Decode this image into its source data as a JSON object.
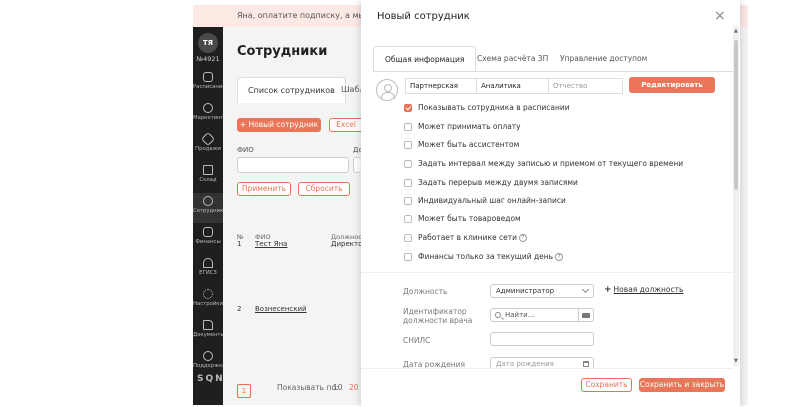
{
  "banner": {
    "text": "Яна, оплатите подписку, а мы поможем"
  },
  "sidebar": {
    "avatar": "TЯ",
    "account": "№4921",
    "items": [
      {
        "label": "Расписание",
        "icon": "calendar-icon"
      },
      {
        "label": "Маркетинг",
        "icon": "chat-icon"
      },
      {
        "label": "Продажи",
        "icon": "tag-icon"
      },
      {
        "label": "Склад",
        "icon": "box-icon"
      },
      {
        "label": "Сотрудники",
        "icon": "user-icon"
      },
      {
        "label": "Финансы",
        "icon": "wallet-icon"
      },
      {
        "label": "ЕГИСЗ",
        "icon": "caduceus-icon"
      },
      {
        "label": "Настройки",
        "icon": "gear-icon"
      },
      {
        "label": "Документы",
        "icon": "document-icon"
      },
      {
        "label": "Поддержка",
        "icon": "help-icon"
      }
    ],
    "logo": "SQNS"
  },
  "main": {
    "title": "Сотрудники",
    "tabs": [
      "Список сотрудников",
      "Шабло"
    ],
    "new_button": "+ Новый сотрудник",
    "excel_button": "Excel",
    "filter_label": "ФИО",
    "filter_label2": "До",
    "apply_button": "Применить",
    "reset_button": "Сбросить",
    "columns": [
      "№",
      "ФИО",
      "Должност"
    ],
    "rows": [
      {
        "num": "1",
        "name": "Тест Яна",
        "position": "Директор"
      },
      {
        "num": "2",
        "name": "Вознесенский",
        "position": ""
      }
    ],
    "pager": {
      "page": "1",
      "show_label": "Показывать по:",
      "opt1": "10",
      "opt2": "20"
    }
  },
  "modal": {
    "title": "Новый сотрудник",
    "close": "×",
    "tabs": [
      "Общая информация",
      "Схема расчёта ЗП",
      "Управление доступом"
    ],
    "name": {
      "last": "Партнерская",
      "first": "Аналитика",
      "middle_placeholder": "Отчество"
    },
    "edit_schedule": "Редактировать график",
    "checkboxes": [
      {
        "label": "Показывать сотрудника в расписании",
        "checked": true,
        "help": false
      },
      {
        "label": "Может принимать оплату",
        "checked": false,
        "help": false
      },
      {
        "label": "Может быть ассистентом",
        "checked": false,
        "help": false
      },
      {
        "label": "Задать интервал между записью и приемом от текущего времени",
        "checked": false,
        "help": false
      },
      {
        "label": "Задать перерыв между двумя записями",
        "checked": false,
        "help": false
      },
      {
        "label": "Индивидуальный шаг онлайн-записи",
        "checked": false,
        "help": false
      },
      {
        "label": "Может быть товароведом",
        "checked": false,
        "help": false
      },
      {
        "label": "Работает в клинике сети",
        "checked": false,
        "help": true
      },
      {
        "label": "Финансы только за текущий день",
        "checked": false,
        "help": true
      }
    ],
    "help_glyph": "?",
    "position_label": "Должность",
    "position_value": "Администратор",
    "new_position_plus": "+",
    "new_position_link": "Новая должность",
    "doctor_id_label": "Идентификатор должности врача",
    "doctor_id_placeholder": "Найти...",
    "snils_label": "СНИЛС",
    "dob_label": "Дата рождения",
    "dob_placeholder": "Дата рождения",
    "save": "Сохранить",
    "save_close": "Сохранить и закрыть"
  },
  "colors": {
    "accent": "#ea7659",
    "sidebar": "#1f1f1f"
  }
}
